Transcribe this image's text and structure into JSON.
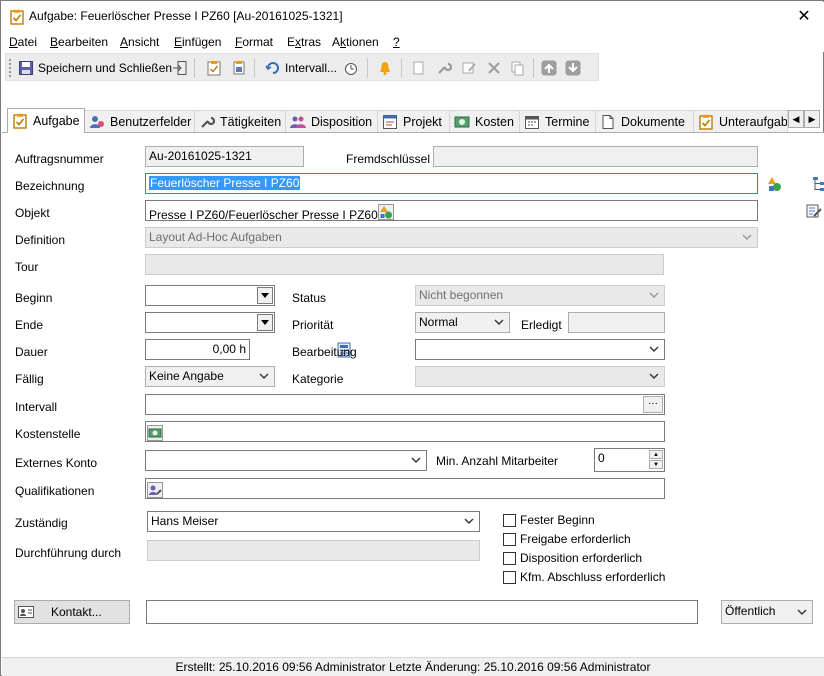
{
  "window": {
    "title": "Aufgabe: Feuerlöscher Presse I PZ60 [Au-20161025-1321]",
    "close_glyph": "✕",
    "icon": "task-clipboard-icon"
  },
  "menu": [
    {
      "label": "Datei",
      "accel": "D"
    },
    {
      "label": "Bearbeiten",
      "accel": "B"
    },
    {
      "label": "Ansicht",
      "accel": "A"
    },
    {
      "label": "Einfügen",
      "accel": "E"
    },
    {
      "label": "Format",
      "accel": "F"
    },
    {
      "label": "Extras",
      "accel": "x"
    },
    {
      "label": "Aktionen",
      "accel": "k"
    },
    {
      "label": "?",
      "accel": "?"
    }
  ],
  "toolbar": {
    "save_close_label": "Speichern und Schließen",
    "interval_label": "Intervall..."
  },
  "tabs": [
    {
      "label": "Aufgabe",
      "icon": "task-clipboard-icon"
    },
    {
      "label": "Benutzerfelder",
      "icon": "user-fields-icon"
    },
    {
      "label": "Tätigkeiten",
      "icon": "wrench-icon"
    },
    {
      "label": "Disposition",
      "icon": "people-icon"
    },
    {
      "label": "Projekt",
      "icon": "project-icon"
    },
    {
      "label": "Kosten",
      "icon": "money-icon"
    },
    {
      "label": "Termine",
      "icon": "calendar-icon"
    },
    {
      "label": "Dokumente",
      "icon": "document-icon"
    },
    {
      "label": "Unteraufgab",
      "icon": "subtask-icon"
    }
  ],
  "form": {
    "auftragsnummer": {
      "label": "Auftragsnummer",
      "value": "Au-20161025-1321"
    },
    "fremdschluessel": {
      "label": "Fremdschlüssel",
      "value": ""
    },
    "bezeichnung": {
      "label": "Bezeichnung",
      "value": "Feuerlöscher Presse I PZ60"
    },
    "objekt": {
      "label": "Objekt",
      "value": "Presse I PZ60/Feuerlöscher Presse I PZ60"
    },
    "definition": {
      "label": "Definition",
      "value": "Layout Ad-Hoc Aufgaben"
    },
    "tour": {
      "label": "Tour",
      "value": ""
    },
    "beginn": {
      "label": "Beginn",
      "value": ""
    },
    "ende": {
      "label": "Ende",
      "value": ""
    },
    "dauer": {
      "label": "Dauer",
      "value": "0,00 h"
    },
    "faellig": {
      "label": "Fällig",
      "value": "Keine Angabe"
    },
    "intervall": {
      "label": "Intervall",
      "value": "",
      "button": "···"
    },
    "kostenstelle": {
      "label": "Kostenstelle",
      "value": ""
    },
    "externes_konto": {
      "label": "Externes Konto",
      "value": ""
    },
    "qualifikationen": {
      "label": "Qualifikationen",
      "value": ""
    },
    "zustaendig": {
      "label": "Zuständig",
      "value": "Hans Meiser"
    },
    "durchfuehrung": {
      "label": "Durchführung durch",
      "value": ""
    },
    "status": {
      "label": "Status",
      "value": "Nicht begonnen"
    },
    "prioritaet": {
      "label": "Priorität",
      "value": "Normal"
    },
    "erledigt": {
      "label": "Erledigt",
      "value": ""
    },
    "bearbeitung": {
      "label": "Bearbeitung",
      "value": ""
    },
    "kategorie": {
      "label": "Kategorie",
      "value": ""
    },
    "min_mitarbeiter": {
      "label": "Min.  Anzahl Mitarbeiter",
      "value": "0"
    },
    "checkboxes": [
      {
        "label": "Fester Beginn",
        "checked": false
      },
      {
        "label": "Freigabe erforderlich",
        "checked": false
      },
      {
        "label": "Disposition erforderlich",
        "checked": false
      },
      {
        "label": "Kfm. Abschluss erforderlich",
        "checked": false
      }
    ],
    "kontakt_button": "Kontakt...",
    "kontakt_value": "",
    "visibility": "Öffentlich"
  },
  "status_bar": {
    "text": "Erstellt: 25.10.2016 09:56 Administrator  Letzte Änderung: 25.10.2016 09:56 Administrator"
  },
  "colors": {
    "selection": "#3399ff",
    "accent_orange": "#e08a00",
    "delete_red": "#d42020"
  }
}
